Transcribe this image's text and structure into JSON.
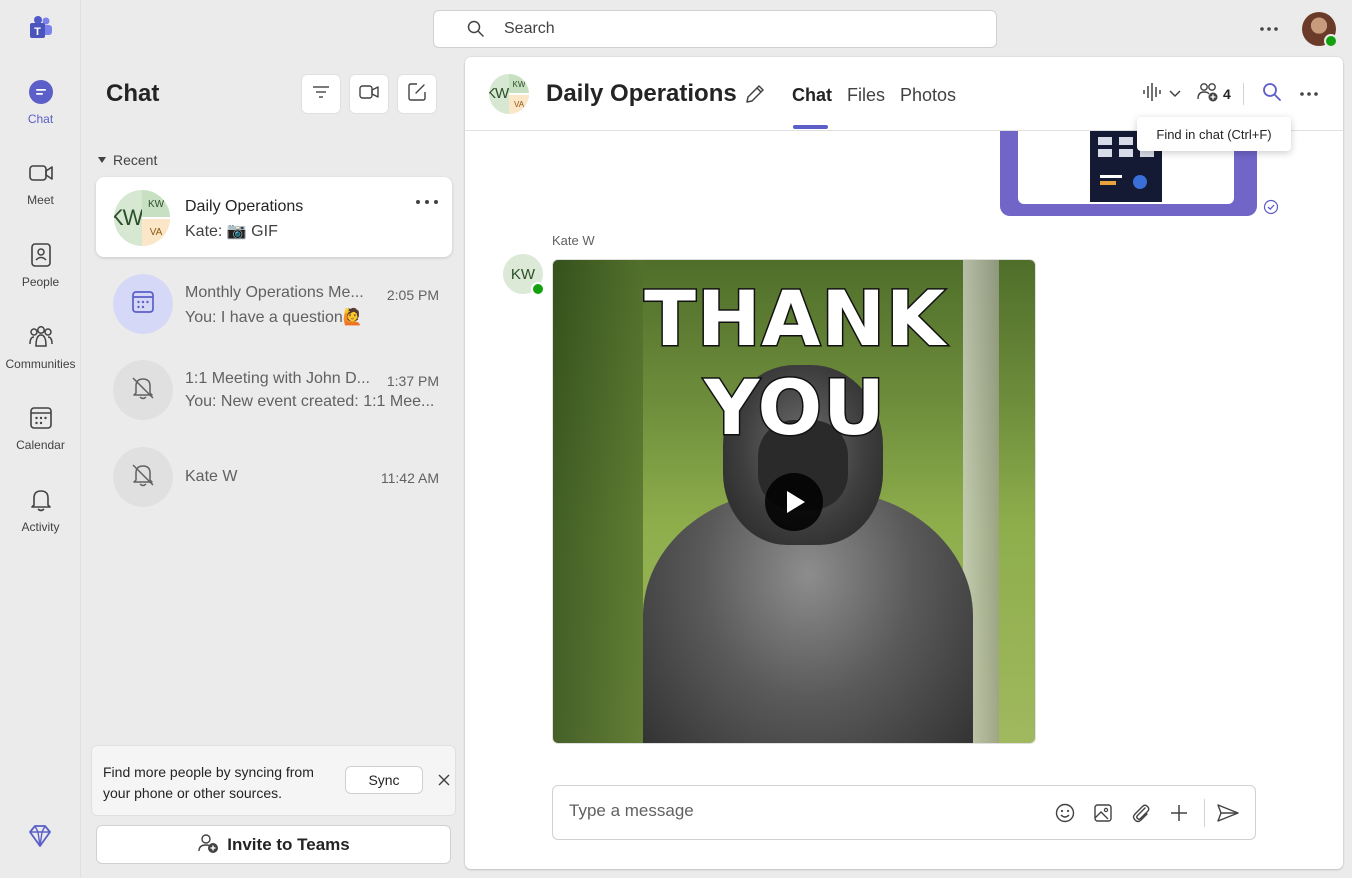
{
  "rail": {
    "items": [
      {
        "label": "Chat",
        "icon": "chat-icon",
        "active": true
      },
      {
        "label": "Meet",
        "icon": "video-icon"
      },
      {
        "label": "People",
        "icon": "people-icon"
      },
      {
        "label": "Communities",
        "icon": "communities-icon"
      },
      {
        "label": "Calendar",
        "icon": "calendar-icon"
      },
      {
        "label": "Activity",
        "icon": "bell-icon"
      }
    ]
  },
  "topbar": {
    "search_placeholder": "Search"
  },
  "chat_list": {
    "title": "Chat",
    "section_label": "Recent",
    "items": [
      {
        "name": "Daily Operations",
        "preview": "Kate: 📷 GIF",
        "time": "",
        "selected": true,
        "avatar": {
          "initials_big": "KW",
          "initials_top": "KW",
          "initials_bottom": "VA"
        }
      },
      {
        "name": "Monthly Operations Me...",
        "preview": "You: I have a question🙋",
        "time": "2:05 PM"
      },
      {
        "name": "1:1 Meeting with John D...",
        "preview": "You: New event created: 1:1 Mee...",
        "time": "1:37 PM"
      },
      {
        "name": "Kate W",
        "preview": "",
        "time": "11:42 AM"
      }
    ],
    "sync_banner": {
      "text": "Find more people by syncing from your phone or other sources.",
      "button": "Sync"
    },
    "invite_label": "Invite to Teams"
  },
  "conversation": {
    "title": "Daily Operations",
    "tabs": [
      "Chat",
      "Files",
      "Photos"
    ],
    "active_tab": "Chat",
    "participant_count": "4",
    "tooltip": "Find in chat (Ctrl+F)",
    "message": {
      "sender": "Kate W",
      "avatar_initials": "KW",
      "gif_caption": "THANK YOU"
    },
    "compose_placeholder": "Type a message"
  },
  "colors": {
    "accent": "#5b5fc7",
    "sent_bubble": "#7166c8",
    "presence": "#13a10e"
  }
}
